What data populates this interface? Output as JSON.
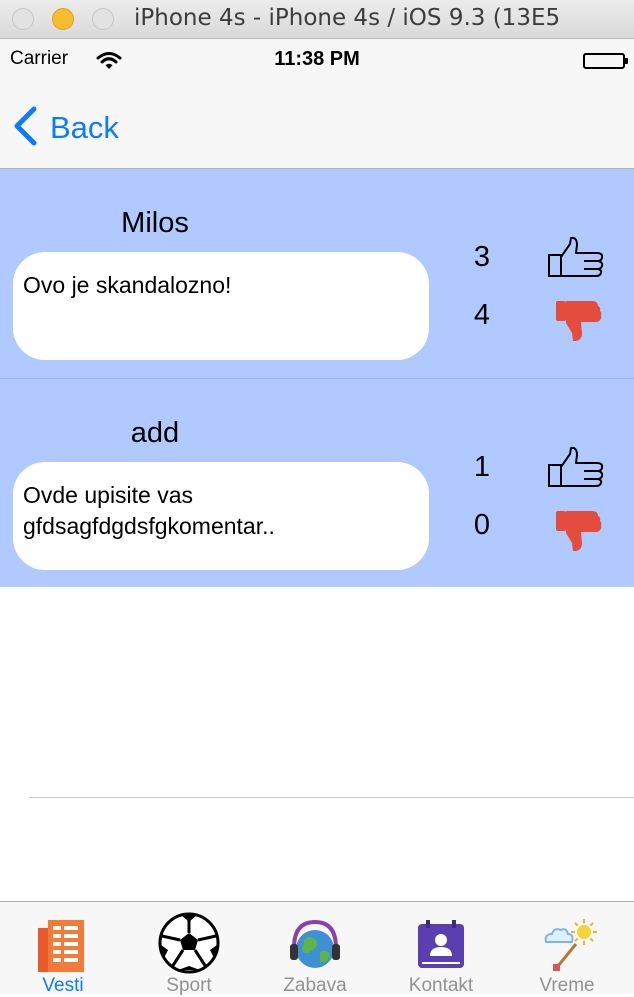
{
  "window": {
    "title": "iPhone 4s - iPhone 4s / iOS 9.3 (13E5"
  },
  "status": {
    "carrier": "Carrier",
    "time": "11:38 PM"
  },
  "nav": {
    "back_label": "Back"
  },
  "comments": [
    {
      "author": "Milos",
      "text": "Ovo je skandalozno!",
      "likes": "3",
      "dislikes": "4"
    },
    {
      "author": "add",
      "text": "Ovde upisite vas gfdsagfdgdsfgkomentar..",
      "likes": "1",
      "dislikes": "0"
    }
  ],
  "tabs": [
    {
      "label": "Vesti",
      "icon": "newspaper-icon",
      "active": true
    },
    {
      "label": "Sport",
      "icon": "soccer-ball-icon",
      "active": false
    },
    {
      "label": "Zabava",
      "icon": "globe-headphones-icon",
      "active": false
    },
    {
      "label": "Kontakt",
      "icon": "contact-card-icon",
      "active": false
    },
    {
      "label": "Vreme",
      "icon": "weather-icon",
      "active": false
    }
  ],
  "colors": {
    "accent": "#0e7afe",
    "comments_bg": "#b0caff",
    "dislike": "#e44c3e"
  }
}
